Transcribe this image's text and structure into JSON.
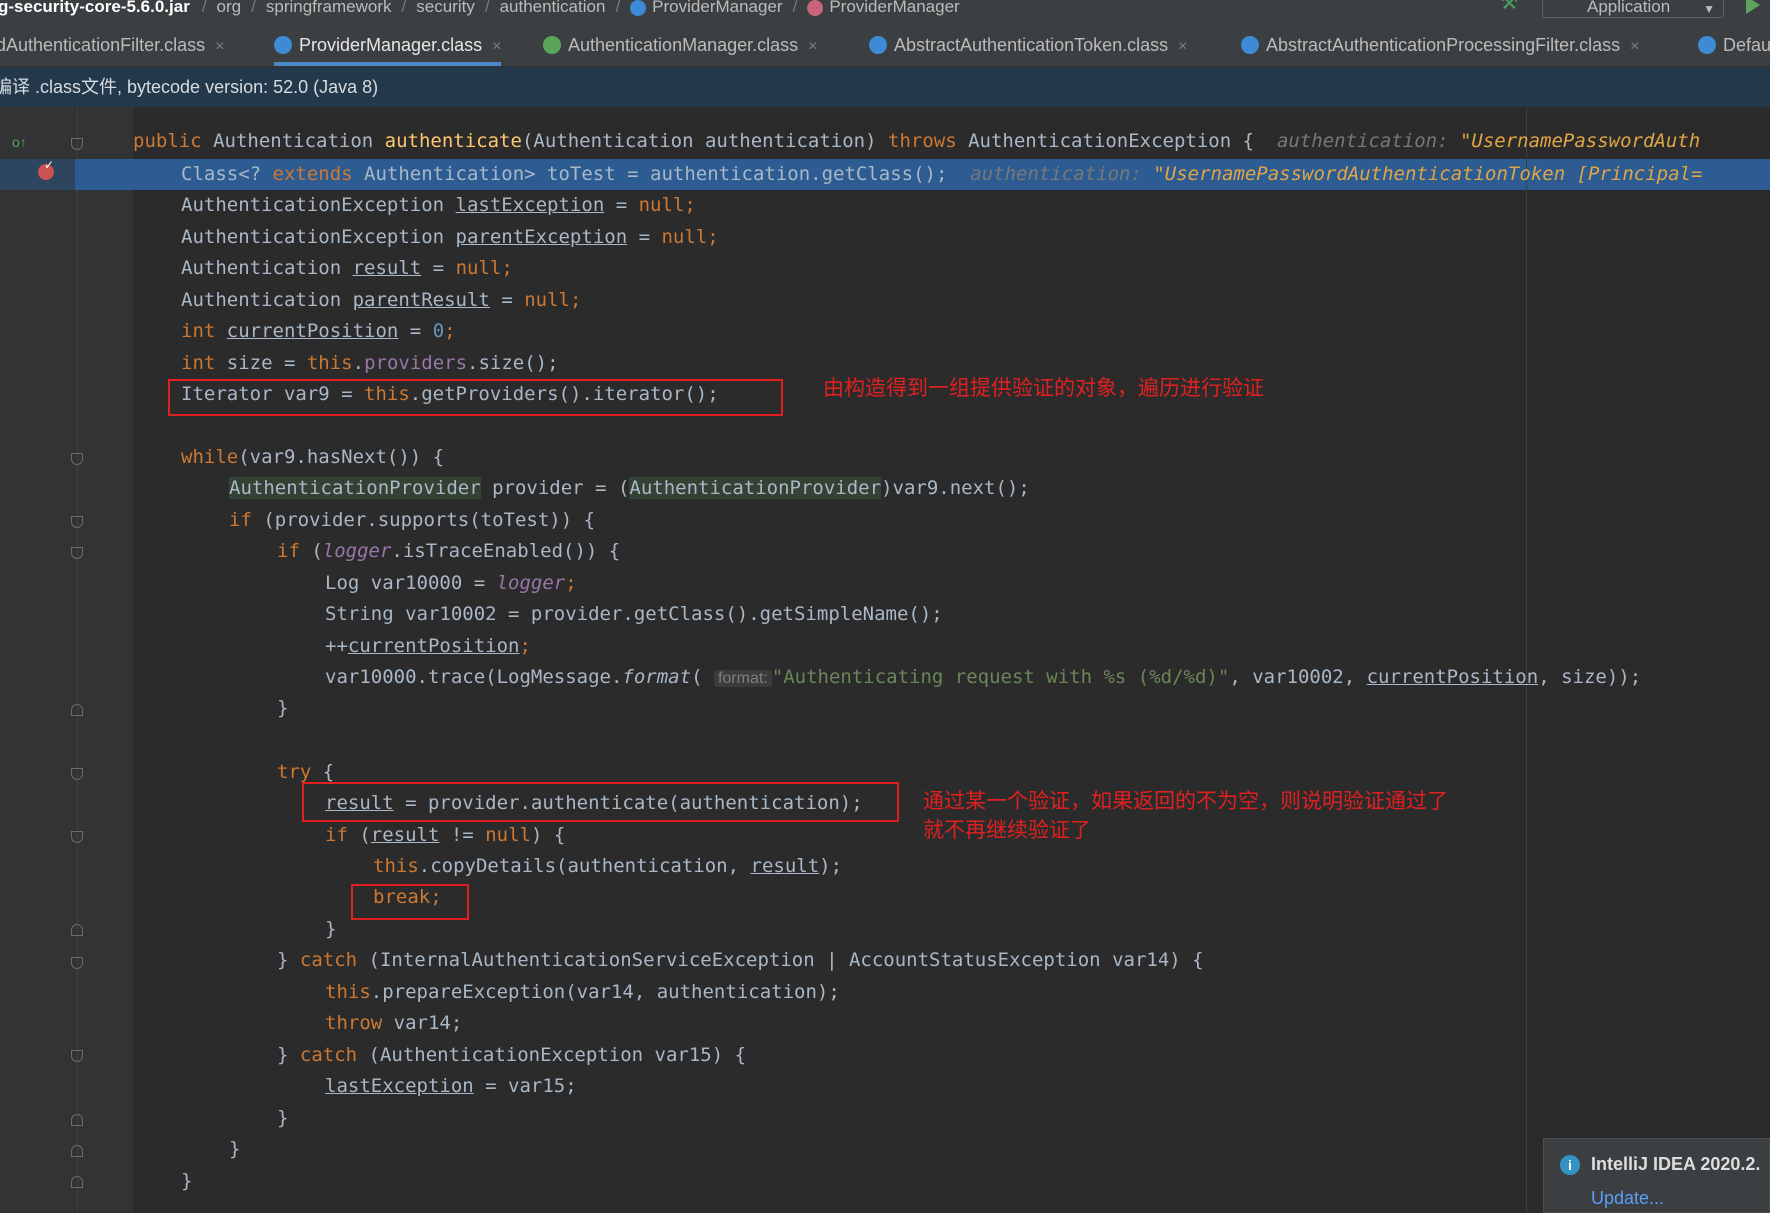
{
  "breadcrumb": [
    "g-security-core-5.6.0.jar",
    "org",
    "springframework",
    "security",
    "authentication",
    "ProviderManager",
    "ProviderManager"
  ],
  "run_config": "Application",
  "tabs": [
    {
      "label": "dAuthenticationFilter.class",
      "icon": "class-icon",
      "active": false
    },
    {
      "label": "ProviderManager.class",
      "icon": "class-icon",
      "active": true
    },
    {
      "label": "AuthenticationManager.class",
      "icon": "interface-icon",
      "active": false
    },
    {
      "label": "AbstractAuthenticationToken.class",
      "icon": "class-icon",
      "active": false
    },
    {
      "label": "AbstractAuthenticationProcessingFilter.class",
      "icon": "class-icon",
      "active": false
    },
    {
      "label": "Defau",
      "icon": "class-icon",
      "active": false
    }
  ],
  "close_glyph": "×",
  "info_bar": "编译 .class文件, bytecode version: 52.0 (Java 8)",
  "code": {
    "l1": {
      "kw1": "public ",
      "t1": "Authentication ",
      "fn": "authenticate",
      "t2": "(Authentication authentication) ",
      "kw2": "throws ",
      "t3": "AuthenticationException {",
      "hint": "  authentication: ",
      "hint_str": "\"UsernamePasswordAuth"
    },
    "l2": {
      "t1": "Class<? ",
      "kw": "extends ",
      "t2": "Authentication> toTest = authentication.getClass();",
      "hint": "  authentication: ",
      "hint_str": "\"UsernamePasswordAuthenticationToken [Principal="
    },
    "l3": {
      "t1": "AuthenticationException ",
      "v": "lastException",
      "t2": " = ",
      "kw": "null",
      "t3": ";"
    },
    "l4": {
      "t1": "AuthenticationException ",
      "v": "parentException",
      "t2": " = ",
      "kw": "null",
      "t3": ";"
    },
    "l5": {
      "t1": "Authentication ",
      "v": "result",
      "t2": " = ",
      "kw": "null",
      "t3": ";"
    },
    "l6": {
      "t1": "Authentication ",
      "v": "parentResult",
      "t2": " = ",
      "kw": "null",
      "t3": ";"
    },
    "l7": {
      "kw": "int ",
      "v": "currentPosition",
      "t2": " = ",
      "num": "0",
      "t3": ";"
    },
    "l8": {
      "kw": "int ",
      "t1": "size = ",
      "kw2": "this",
      "t2": ".",
      "f": "providers",
      "t3": ".size();"
    },
    "l9": {
      "t1": "Iterator var9 = ",
      "kw": "this",
      "t2": ".getProviders().iterator();"
    },
    "l11": {
      "kw": "while",
      "t1": "(var9.hasNext()) {"
    },
    "l12": {
      "h1": "AuthenticationProvider",
      "t1": " provider = (",
      "h2": "AuthenticationProvider",
      "t2": ")var9.next();"
    },
    "l13": {
      "kw": "if ",
      "t1": "(provider.supports(toTest)) {"
    },
    "l14": {
      "kw": "if ",
      "t1": "(",
      "f": "logger",
      "t2": ".isTraceEnabled()) {"
    },
    "l15": {
      "t1": "Log var10000 = ",
      "f": "logger",
      "t2": ";"
    },
    "l16": {
      "t1": "String var10002 = provider.getClass().getSimpleName();"
    },
    "l17": {
      "t1": "++",
      "v": "currentPosition",
      "t2": ";"
    },
    "l18": {
      "t1": "var10000.trace(LogMessage.",
      "fi": "format",
      "t2": "( ",
      "param": "format:",
      "str": "\"Authenticating request with %s (%d/%d)\"",
      "t3": ", var10002, ",
      "v": "currentPosition",
      "t4": ", size));"
    },
    "l19": {
      "t1": "}"
    },
    "l21": {
      "kw": "try ",
      "t1": "{"
    },
    "l22": {
      "v": "result",
      "t1": " = provider.authenticate(authentication);"
    },
    "l23": {
      "kw": "if ",
      "t1": "(",
      "v": "result",
      "t2": " != ",
      "kw2": "null",
      "t3": ") {"
    },
    "l24": {
      "kw": "this",
      "t1": ".copyDetails(authentication, ",
      "v": "result",
      "t2": ");"
    },
    "l25": {
      "kw": "break;"
    },
    "l26": {
      "t1": "}"
    },
    "l27": {
      "t1": "} ",
      "kw": "catch ",
      "t2": "(InternalAuthenticationServiceException | AccountStatusException var14) {"
    },
    "l28": {
      "kw": "this",
      "t1": ".prepareException(var14, authentication);"
    },
    "l29": {
      "kw": "throw ",
      "t1": "var14;"
    },
    "l30": {
      "t1": "} ",
      "kw": "catch ",
      "t2": "(AuthenticationException var15) {"
    },
    "l31": {
      "v": "lastException",
      "t1": " = var15;"
    },
    "l32": {
      "t1": "}"
    },
    "l33": {
      "t1": "}"
    },
    "l34": {
      "t1": "}"
    }
  },
  "annotations": {
    "note1": "由构造得到一组提供验证的对象，遍历进行验证",
    "note2_line1": "通过某一个验证，如果返回的不为空，则说明验证通过了",
    "note2_line2": "就不再继续验证了"
  },
  "notification": {
    "title": "IntelliJ IDEA 2020.2.",
    "link": "Update..."
  },
  "colors": {
    "keyword": "#cc7832",
    "method": "#ffc66d",
    "number": "#6897bb",
    "string": "#6a8759",
    "field": "#9876aa",
    "exec_line": "#2d5c92",
    "annotation": "#e02020"
  }
}
